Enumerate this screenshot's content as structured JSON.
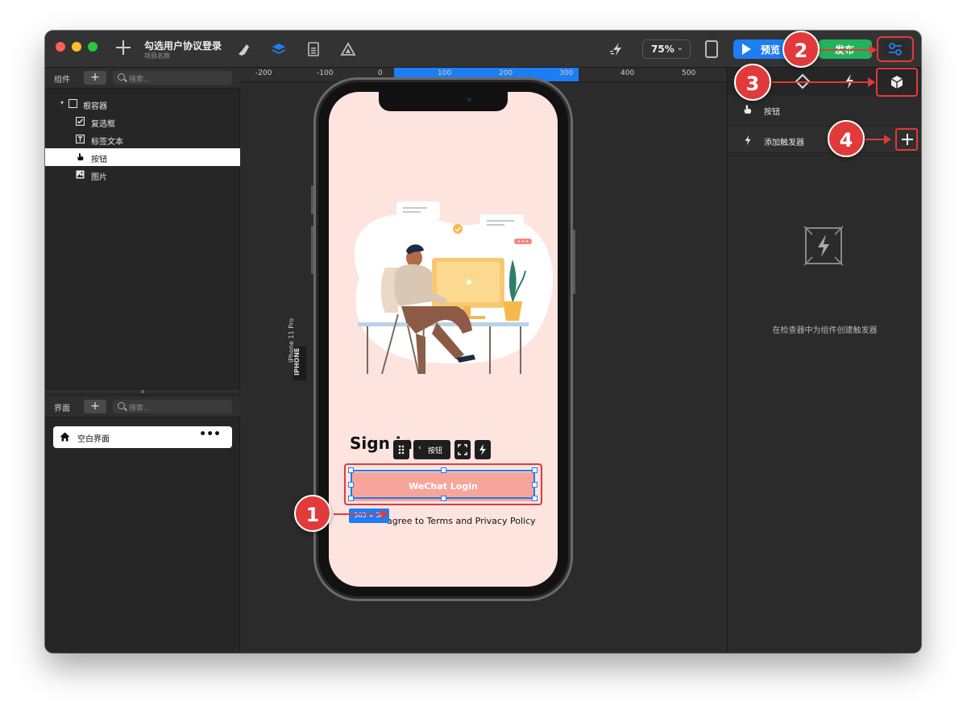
{
  "app": {
    "title": "勾选用户协议登录",
    "subtitle": "项目名称"
  },
  "toolbar": {
    "zoom": "75%",
    "preview_label": "预览",
    "publish_label": "发布",
    "icons": [
      "pen-icon",
      "layers-icon",
      "document-icon",
      "drive-icon",
      "lightning-icon",
      "device-icon",
      "settings-sliders-icon"
    ]
  },
  "left_panel": {
    "components_label": "组件",
    "add_label": "+",
    "search_placeholder": "搜索...",
    "tree": [
      {
        "label": "根容器",
        "icon": "checkbox-outline-icon"
      },
      {
        "label": "复选框",
        "icon": "checkbox-icon"
      },
      {
        "label": "标签文本",
        "icon": "text-icon"
      },
      {
        "label": "按钮",
        "icon": "hand-icon",
        "selected": true
      },
      {
        "label": "图片",
        "icon": "image-icon"
      }
    ],
    "screens_label": "界面",
    "screens": [
      {
        "label": "空白界面",
        "more": "•••"
      }
    ]
  },
  "ruler": {
    "ticks": [
      "-200",
      "-100",
      "0",
      "100",
      "200",
      "300",
      "400",
      "500"
    ]
  },
  "canvas": {
    "device_label": "iPhone 11 Pro",
    "device_tag": "IPHONE",
    "phone": {
      "heading": "Sign in",
      "button_label": "WeChat Login",
      "agreement": "agree to Terms and Privacy Policy"
    },
    "floating_toolbar": {
      "component": "按钮"
    },
    "size_badge": "305 × 50"
  },
  "right_panel": {
    "component_name": "按钮",
    "add_trigger_label": "添加触发器",
    "empty_text": "在检查器中为组件创建触发器"
  },
  "callouts": [
    "1",
    "2",
    "3",
    "4"
  ],
  "colors": {
    "accent_blue": "#1d7df2",
    "publish_green": "#21b35c",
    "annotation_red": "#e23a3a",
    "phone_bg": "#fde4df",
    "button_pink": "#f7a59b"
  }
}
